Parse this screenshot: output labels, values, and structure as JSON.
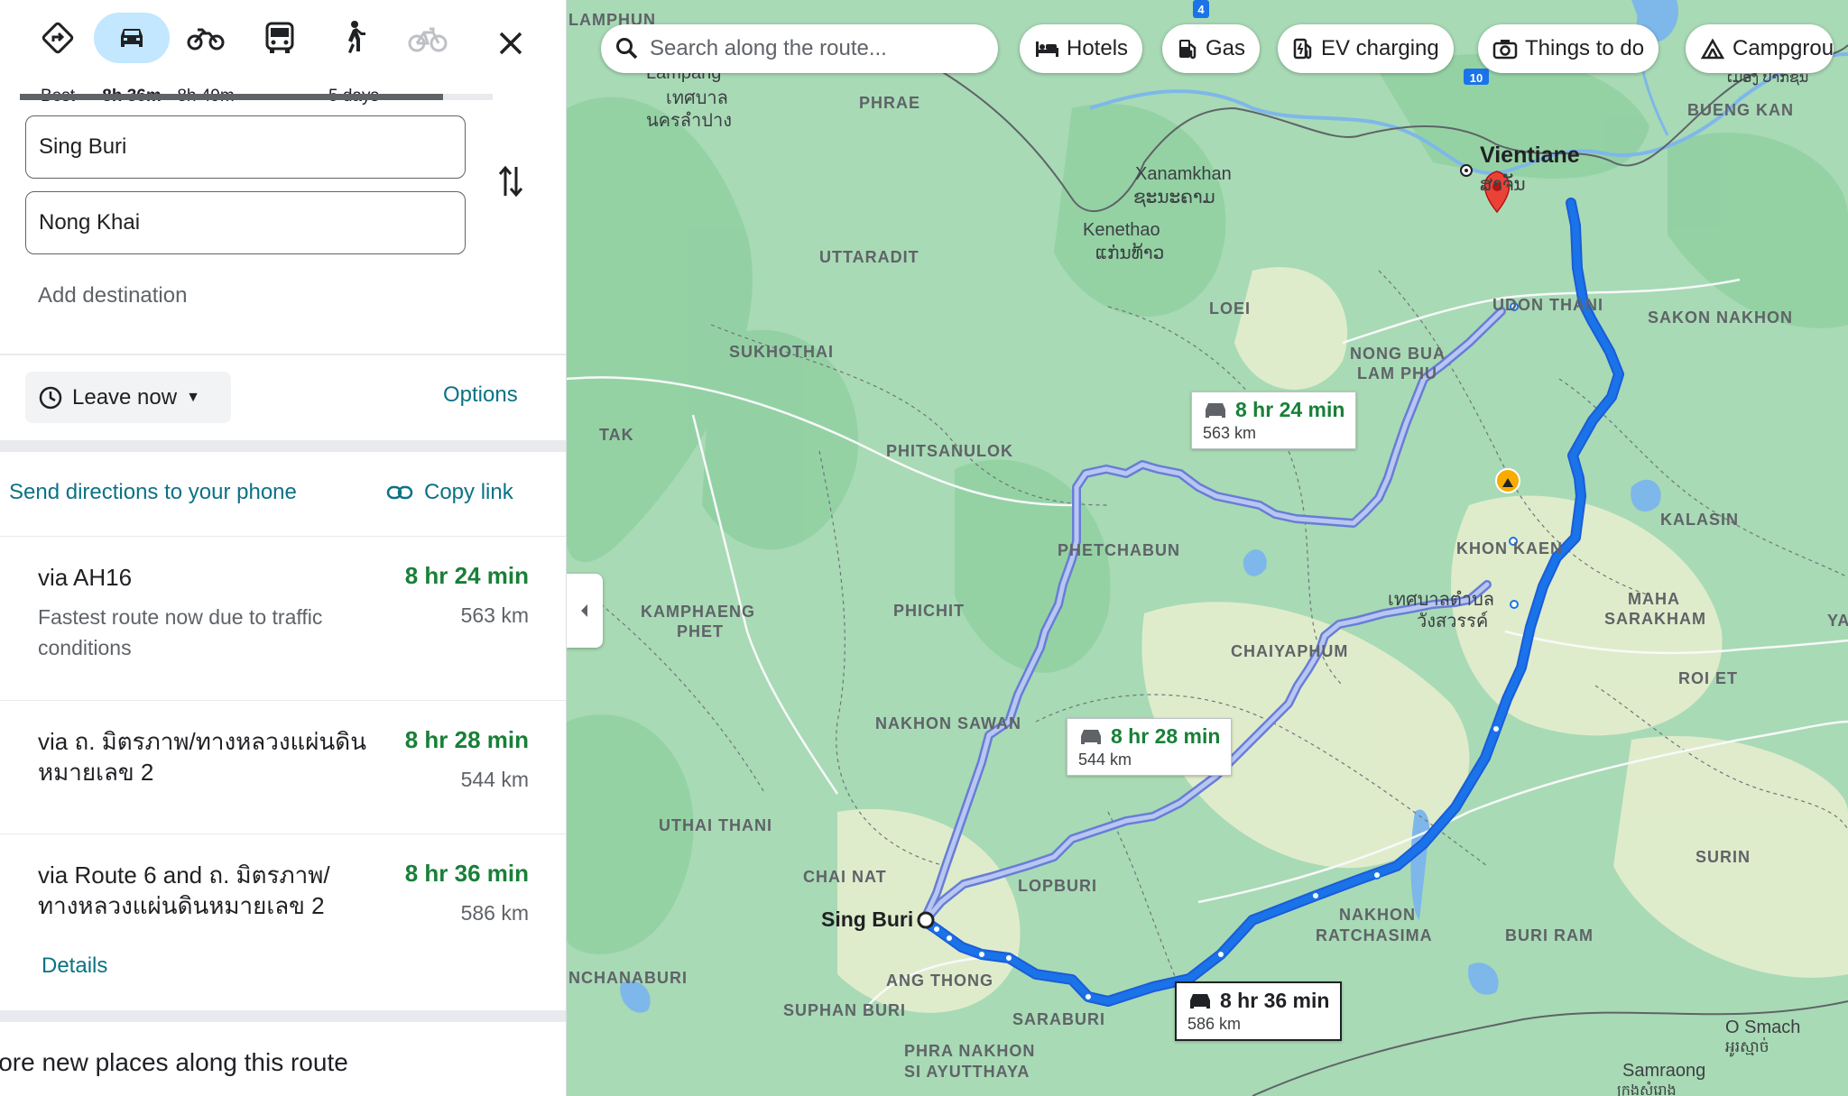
{
  "modes": [
    {
      "name": "best",
      "label": "Best"
    },
    {
      "name": "driving",
      "label": "8h 36m"
    },
    {
      "name": "motorcycle",
      "label": "8h 49m"
    },
    {
      "name": "transit",
      "label": ""
    },
    {
      "name": "walking",
      "label": "5 days"
    },
    {
      "name": "cycling",
      "label": "—"
    }
  ],
  "origin": "Sing Buri",
  "destination": "Nong Khai",
  "add_destination": "Add destination",
  "leave_now": "Leave now",
  "options": "Options",
  "send_directions": "Send directions to your phone",
  "copy_link": "Copy link",
  "routes": [
    {
      "name": "via AH16",
      "desc": "Fastest route now due to traffic conditions",
      "time": "8 hr 24 min",
      "dist": "563 km"
    },
    {
      "name": "via ถ. มิตรภาพ/ทางหลวงแผ่นดินหมายเลข 2",
      "desc": "",
      "time": "8 hr 28 min",
      "dist": "544 km"
    },
    {
      "name": "via Route 6 and ถ. มิตรภาพ/ทางหลวงแผ่นดินหมายเลข 2",
      "desc": "",
      "time": "8 hr 36 min",
      "dist": "586 km"
    }
  ],
  "details": "Details",
  "explore": "lore new places along this route",
  "map": {
    "search_placeholder": "Search along the route...",
    "chips": [
      "Hotels",
      "Gas",
      "EV charging",
      "Things to do",
      "Campgrou"
    ],
    "callouts": [
      {
        "time": "8 hr 24 min",
        "dist": "563 km"
      },
      {
        "time": "8 hr 28 min",
        "dist": "544 km"
      },
      {
        "time": "8 hr 36 min",
        "dist": "586 km"
      }
    ],
    "labels": {
      "lamphun": "LAMPHUN",
      "lampang": "Lampang",
      "lampang_th": "เทศบาล",
      "lampang_th2": "นครลำปาง",
      "phrae": "PHRAE",
      "uttaradit": "UTTARADIT",
      "sukhothai": "SUKHOTHAI",
      "tak": "TAK",
      "phitsanulok": "PHITSANULOK",
      "phetchabun": "PHETCHABUN",
      "phichit": "PHICHIT",
      "kamphaeng": "KAMPHAENG",
      "kamphaeng2": "PHET",
      "nakhon_sawan": "NAKHON SAWAN",
      "uthai": "UTHAI THANI",
      "chai_nat": "CHAI NAT",
      "lopburi": "LOPBURI",
      "sing_buri": "Sing Buri",
      "ang_thong": "ANG THONG",
      "kanchanaburi": "NCHANABURI",
      "suphan": "SUPHAN BURI",
      "saraburi": "SARABURI",
      "ayutthaya1": "PHRA NAKHON",
      "ayutthaya2": "SI AYUTTHAYA",
      "xanamkhan": "Xanamkhan",
      "xanamkhan_lo": "ຊະນະຄາມ",
      "kenethao": "Kenethao",
      "kenethao_lo": "ແກ່ນທ້າວ",
      "loei": "LOEI",
      "nong_bua1": "NONG BUA",
      "nong_bua2": "LAM PHU",
      "vientiane": "Vientiane",
      "vientiane_lo": "ສາຈັນ",
      "udon": "UDON THANI",
      "sakon": "SAKON NAKHON",
      "bueng_kan": "BUENG KAN",
      "bueng_lo": "ເມືອງ ປາກຊັນ",
      "khon_kaen": "KHON KAEN",
      "kalasin": "KALASIN",
      "wang1": "เทศบาลตำบล",
      "wang2": "วังสวรรค์",
      "maha1": "MAHA",
      "maha2": "SARAKHAM",
      "chaiyaphum": "CHAIYAPHUM",
      "roi_et": "ROI ET",
      "ya": "YA",
      "surin": "SURIN",
      "nakhon_r1": "NAKHON",
      "nakhon_r2": "RATCHASIMA",
      "buri_ram": "BURI RAM",
      "o_smach": "O Smach",
      "o_smach_km": "អូរស្មាច់",
      "samraong": "Samraong",
      "samraong_km": "ក្រុងសំរោង"
    }
  }
}
